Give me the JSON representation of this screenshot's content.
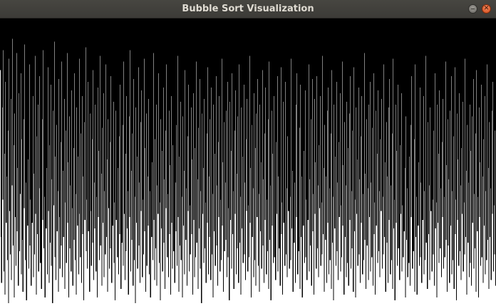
{
  "window": {
    "title": "Bubble Sort Visualization",
    "close_glyph": "✕"
  },
  "visualization": {
    "type": "bar",
    "algorithm": "bubble-sort",
    "bar_color": "#000000",
    "background_color": "#ffffff",
    "bars_from": "top"
  },
  "chart_data": {
    "type": "bar",
    "categories": [],
    "values": [
      0.18,
      0.76,
      0.92,
      0.31,
      0.63,
      0.11,
      0.88,
      0.47,
      0.96,
      0.22,
      0.71,
      0.55,
      0.84,
      0.39,
      0.99,
      0.14,
      0.67,
      0.82,
      0.28,
      0.91,
      0.58,
      0.07,
      0.79,
      0.44,
      0.97,
      0.33,
      0.69,
      0.86,
      0.12,
      0.74,
      0.52,
      0.93,
      0.26,
      0.81,
      0.61,
      0.19,
      0.89,
      0.42,
      0.77,
      0.95,
      0.35,
      0.66,
      0.09,
      0.84,
      0.57,
      0.98,
      0.24,
      0.72,
      0.49,
      0.87,
      0.16,
      0.79,
      0.63,
      0.93,
      0.38,
      0.71,
      0.27,
      0.9,
      0.54,
      0.82,
      0.13,
      0.68,
      0.96,
      0.41,
      0.75,
      0.3,
      0.88,
      0.59,
      0.2,
      0.85,
      0.46,
      0.94,
      0.35,
      0.7,
      0.11,
      0.8,
      0.62,
      0.97,
      0.29,
      0.73,
      0.52,
      0.89,
      0.17,
      0.67,
      0.92,
      0.44,
      0.78,
      0.23,
      0.86,
      0.56,
      0.99,
      0.32,
      0.65,
      0.08,
      0.83,
      0.48,
      0.91,
      0.37,
      0.74,
      0.6,
      0.95,
      0.21,
      0.69,
      0.87,
      0.43,
      0.79,
      0.15,
      0.9,
      0.53,
      0.76,
      0.28,
      0.94,
      0.64,
      0.39,
      0.85,
      0.12,
      0.71,
      0.5,
      0.97,
      0.34,
      0.8,
      0.58,
      0.88,
      0.25,
      0.66,
      0.93,
      0.45,
      0.77,
      0.19,
      0.84,
      0.61,
      0.96,
      0.31,
      0.72,
      0.48,
      0.89,
      0.14,
      0.68,
      0.83,
      0.4,
      0.92,
      0.27,
      0.75,
      0.55,
      0.98,
      0.36,
      0.7,
      0.1,
      0.81,
      0.63,
      0.87,
      0.22,
      0.74,
      0.51,
      0.95,
      0.33,
      0.67,
      0.86,
      0.42,
      0.78,
      0.18,
      0.91,
      0.57,
      0.73,
      0.3,
      0.88,
      0.62,
      0.97,
      0.24,
      0.69,
      0.46,
      0.84,
      0.13,
      0.79,
      0.54,
      0.93,
      0.38,
      0.71,
      0.26,
      0.9,
      0.6,
      0.82,
      0.16,
      0.76,
      0.49,
      0.95,
      0.35,
      0.66,
      0.87,
      0.43,
      0.8,
      0.2,
      0.92,
      0.58,
      0.72,
      0.29,
      0.85,
      0.64,
      0.98,
      0.32,
      0.7,
      0.09,
      0.83,
      0.52,
      0.89,
      0.41,
      0.75,
      0.23,
      0.94,
      0.56,
      0.78,
      0.37,
      0.86,
      0.15,
      0.68,
      0.91,
      0.47,
      0.81,
      0.27,
      0.73,
      0.6,
      0.96,
      0.34,
      0.69,
      0.11,
      0.88,
      0.53,
      0.77,
      0.4,
      0.93,
      0.21,
      0.84,
      0.62,
      0.99,
      0.31,
      0.71,
      0.48,
      0.87,
      0.17,
      0.79,
      0.57,
      0.92,
      0.36,
      0.67,
      0.25,
      0.9,
      0.63,
      0.82,
      0.14,
      0.74,
      0.45,
      0.95,
      0.33,
      0.86,
      0.55,
      0.72,
      0.28,
      0.89,
      0.6,
      0.97,
      0.22,
      0.76,
      0.5,
      0.84,
      0.12,
      0.7,
      0.91,
      0.42,
      0.8,
      0.3,
      0.93,
      0.58,
      0.68,
      0.19,
      0.85,
      0.64,
      0.98,
      0.35,
      0.73,
      0.46,
      0.88,
      0.24,
      0.78,
      0.56,
      0.94,
      0.39,
      0.66,
      0.16,
      0.83,
      0.61,
      0.9,
      0.32,
      0.75,
      0.51,
      0.96,
      0.27,
      0.71,
      0.87,
      0.44,
      0.81,
      0.2,
      0.92,
      0.57,
      0.74,
      0.37,
      0.86,
      0.13,
      0.69,
      0.95,
      0.48,
      0.79,
      0.29,
      0.84,
      0.62,
      0.97,
      0.34,
      0.72,
      0.53,
      0.89,
      0.18,
      0.77,
      0.59,
      0.93,
      0.41,
      0.67,
      0.23,
      0.88,
      0.65,
      0.82,
      0.31,
      0.75,
      0.49,
      0.96,
      0.26,
      0.7,
      0.9,
      0.45,
      0.83,
      0.15,
      0.78,
      0.56,
      0.94,
      0.38,
      0.73,
      0.21,
      0.87,
      0.6,
      0.99,
      0.33,
      0.68,
      0.52,
      0.85,
      0.28,
      0.8,
      0.64,
      0.92,
      0.4,
      0.71,
      0.17,
      0.89,
      0.55,
      0.76,
      0.35,
      0.91,
      0.24,
      0.82,
      0.61,
      0.97,
      0.3,
      0.74,
      0.47,
      0.86,
      0.2,
      0.79,
      0.58,
      0.93,
      0.43,
      0.69,
      0.27,
      0.88,
      0.63,
      0.84,
      0.14,
      0.72,
      0.5,
      0.95,
      0.36,
      0.81,
      0.57,
      0.77,
      0.32,
      0.9,
      0.22,
      0.83,
      0.66,
      0.98,
      0.29,
      0.7,
      0.46,
      0.87,
      0.19,
      0.75,
      0.6,
      0.94,
      0.39,
      0.68,
      0.25,
      0.89,
      0.54,
      0.8,
      0.34,
      0.92,
      0.16,
      0.78,
      0.62,
      0.96,
      0.31,
      0.73,
      0.48,
      0.85,
      0.23,
      0.82,
      0.57,
      0.91,
      0.42,
      0.67,
      0.28,
      0.88,
      0.65,
      0.83,
      0.13,
      0.71,
      0.52,
      0.97,
      0.37,
      0.76,
      0.59,
      0.9,
      0.26,
      0.84,
      0.45,
      0.93,
      0.33,
      0.69,
      0.21,
      0.86,
      0.61,
      0.95,
      0.3,
      0.74,
      0.5,
      0.87,
      0.18,
      0.79,
      0.56,
      0.92,
      0.4,
      0.7,
      0.24,
      0.89,
      0.63,
      0.81,
      0.35,
      0.94,
      0.15,
      0.77,
      0.58,
      0.98,
      0.32,
      0.72,
      0.47,
      0.85,
      0.27,
      0.83,
      0.6,
      0.91,
      0.43,
      0.68,
      0.2,
      0.88,
      0.55,
      0.8,
      0.36,
      0.93,
      0.17,
      0.75,
      0.64,
      0.96,
      0.29,
      0.71,
      0.49,
      0.86,
      0.22,
      0.82,
      0.59,
      0.9,
      0.41,
      0.67,
      0.26,
      0.87,
      0.62,
      0.84,
      0.14,
      0.73,
      0.53,
      0.95,
      0.34,
      0.78,
      0.57,
      0.92,
      0.3,
      0.69,
      0.19,
      0.89,
      0.6,
      0.81,
      0.38,
      0.94,
      0.23,
      0.76,
      0.55,
      0.97,
      0.31,
      0.72,
      0.46,
      0.85,
      0.25,
      0.83,
      0.63,
      0.91,
      0.42,
      0.7,
      0.16,
      0.88,
      0.56,
      0.79,
      0.35,
      0.93,
      0.21,
      0.74,
      0.61,
      0.96,
      0.28,
      0.68,
      0.5,
      0.87,
      0.2,
      0.8,
      0.58,
      0.9,
      0.44,
      0.66,
      0.27,
      0.86,
      0.64,
      0.82,
      0.13,
      0.75,
      0.52,
      0.95,
      0.37,
      0.77,
      0.55,
      0.92,
      0.32,
      0.71,
      0.24,
      0.89,
      0.59,
      0.84,
      0.4,
      0.94,
      0.18,
      0.78,
      0.62,
      0.98,
      0.3,
      0.73,
      0.48,
      0.86,
      0.22,
      0.81,
      0.57,
      0.91,
      0.43,
      0.69,
      0.26,
      0.88,
      0.65,
      0.83,
      0.15,
      0.72,
      0.51,
      0.96,
      0.36,
      0.76,
      0.58,
      0.9,
      0.29,
      0.85,
      0.45,
      0.93,
      0.33,
      0.7,
      0.2,
      0.87,
      0.6,
      0.8,
      0.39,
      0.95,
      0.17,
      0.74,
      0.63,
      0.97,
      0.31,
      0.68,
      0.49,
      0.86,
      0.24,
      0.82,
      0.56,
      0.92,
      0.41,
      0.71,
      0.27,
      0.89,
      0.61,
      0.84,
      0.12,
      0.77,
      0.54,
      0.94,
      0.35,
      0.79,
      0.59,
      0.91,
      0.3,
      0.69,
      0.22,
      0.88,
      0.57,
      0.83,
      0.38,
      0.93,
      0.19,
      0.75,
      0.64,
      0.96,
      0.32,
      0.72,
      0.47,
      0.85,
      0.25,
      0.81,
      0.6,
      0.9,
      0.42,
      0.67,
      0.28,
      0.87,
      0.62,
      0.82,
      0.16,
      0.76,
      0.5,
      0.95,
      0.36,
      0.78,
      0.55,
      0.92,
      0.31,
      0.7,
      0.21,
      0.89,
      0.58,
      0.84,
      0.4,
      0.94,
      0.14,
      0.73,
      0.63,
      0.98,
      0.3,
      0.71,
      0.46,
      0.86,
      0.23,
      0.8,
      0.56,
      0.91,
      0.44,
      0.68,
      0.26,
      0.88,
      0.65,
      0.83,
      0.18,
      0.74,
      0.52,
      0.97,
      0.34,
      0.77,
      0.59,
      0.9,
      0.29,
      0.85,
      0.48,
      0.93,
      0.37,
      0.69,
      0.2,
      0.87,
      0.61,
      0.81,
      0.42,
      0.95,
      0.16,
      0.76,
      0.62,
      0.96,
      0.33,
      0.72,
      0.5,
      0.86,
      0.24,
      0.83,
      0.57,
      0.92,
      0.4,
      0.7,
      0.27,
      0.89,
      0.6,
      0.84,
      0.13,
      0.78,
      0.55,
      0.94,
      0.36,
      0.75,
      0.58,
      0.91,
      0.31,
      0.67,
      0.22,
      0.88,
      0.63,
      0.82,
      0.39,
      0.93,
      0.19,
      0.73,
      0.64,
      0.97,
      0.3,
      0.71,
      0.47,
      0.85,
      0.25,
      0.8,
      0.59,
      0.9,
      0.43,
      0.69,
      0.28,
      0.87,
      0.62,
      0.83,
      0.15,
      0.77,
      0.51,
      0.95,
      0.35,
      0.79,
      0.56,
      0.92,
      0.32,
      0.72,
      0.2,
      0.89,
      0.6,
      0.84,
      0.41,
      0.94,
      0.17,
      0.75,
      0.63,
      0.98,
      0.33,
      0.7,
      0.49,
      0.86,
      0.26,
      0.81,
      0.58,
      0.91,
      0.45,
      0.68,
      0.29,
      0.88,
      0.64,
      0.82,
      0.14,
      0.76,
      0.53,
      0.96,
      0.37,
      0.78,
      0.57,
      0.9,
      0.3,
      0.85,
      0.46,
      0.93,
      0.34,
      0.71,
      0.21,
      0.87,
      0.61,
      0.8,
      0.4,
      0.95,
      0.18,
      0.74,
      0.62,
      0.97,
      0.31,
      0.69,
      0.5,
      0.86,
      0.23,
      0.83,
      0.55,
      0.92,
      0.42,
      0.72,
      0.27,
      0.89,
      0.6,
      0.84,
      0.16,
      0.77,
      0.52,
      0.94,
      0.36,
      0.76,
      0.59,
      0.91,
      0.32,
      0.68,
      0.22,
      0.88,
      0.65,
      0.82,
      0.39,
      0.93
    ]
  }
}
